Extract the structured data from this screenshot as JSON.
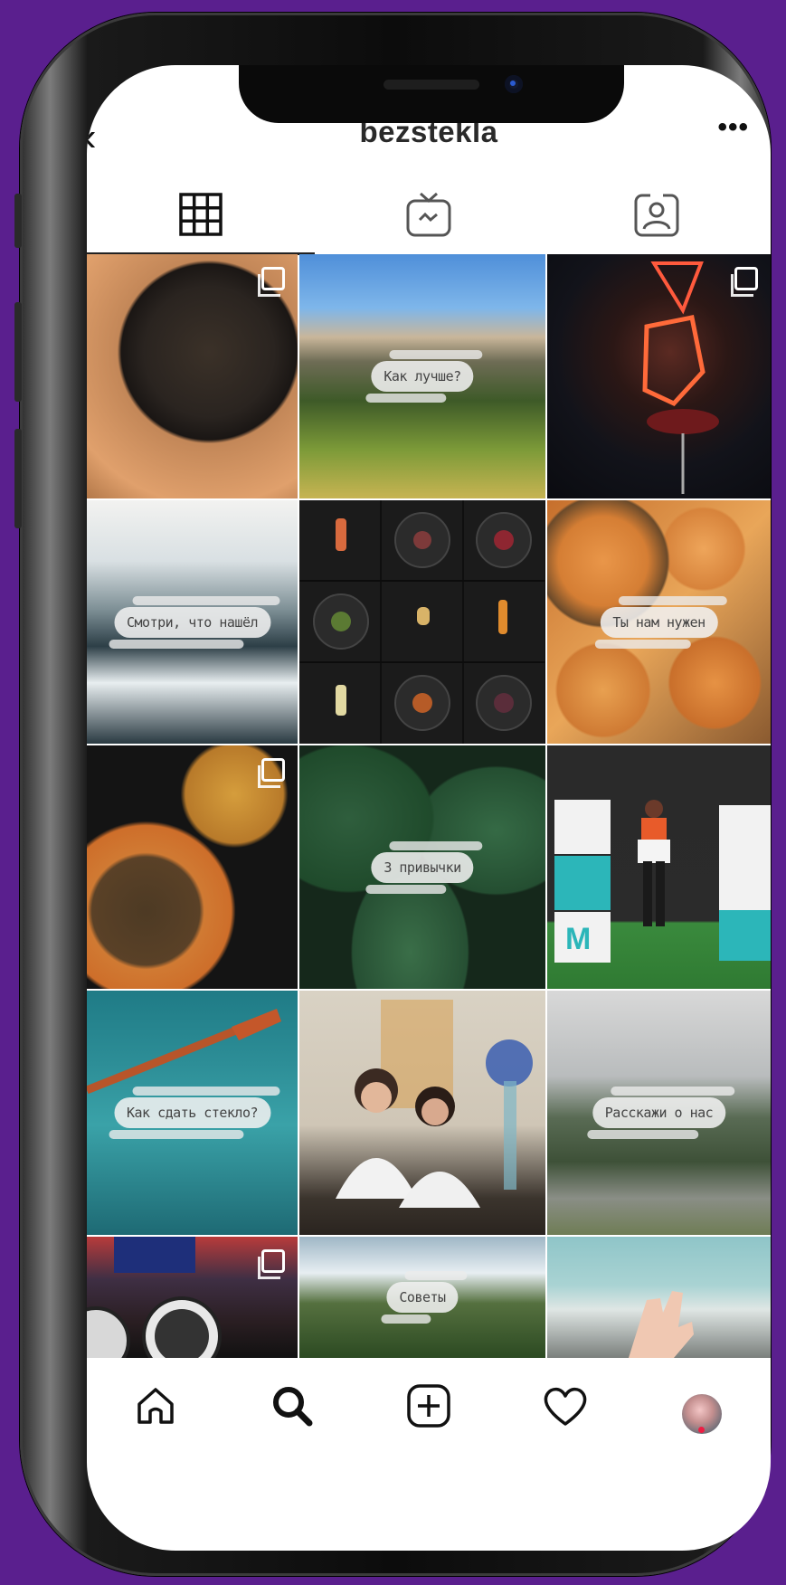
{
  "header": {
    "username": "bezstekla",
    "back_icon": "chevron-left",
    "more_label": "•••"
  },
  "tabs": [
    {
      "name": "grid",
      "icon": "grid-icon",
      "selected": true
    },
    {
      "name": "igtv",
      "icon": "tv-icon",
      "selected": false
    },
    {
      "name": "tagged",
      "icon": "person-tag-icon",
      "selected": false
    }
  ],
  "posts": [
    {
      "id": "escargot",
      "caption": "",
      "multi": true
    },
    {
      "id": "mountains",
      "caption": "Как лучше?",
      "multi": false
    },
    {
      "id": "neon-fist",
      "caption": "",
      "multi": true
    },
    {
      "id": "sea-rocks",
      "caption": "Смотри, что нашёл",
      "multi": false
    },
    {
      "id": "dishes-grid",
      "caption": "",
      "multi": false
    },
    {
      "id": "pumpkins",
      "caption": "Ты нам нужен",
      "multi": false
    },
    {
      "id": "food-plate",
      "caption": "",
      "multi": true
    },
    {
      "id": "leaves",
      "caption": "3 привычки",
      "multi": false
    },
    {
      "id": "exhibit",
      "caption": "",
      "multi": false
    },
    {
      "id": "paddle-sea",
      "caption": "Как сдать стекло?",
      "multi": false
    },
    {
      "id": "two-girls",
      "caption": "",
      "multi": false
    },
    {
      "id": "road-valley",
      "caption": "Расскажи о нас",
      "multi": false
    },
    {
      "id": "coasters",
      "caption": "",
      "multi": true
    },
    {
      "id": "mountain-clouds",
      "caption": "Советы",
      "multi": false
    },
    {
      "id": "hand-fog",
      "caption": "",
      "multi": false
    }
  ],
  "bottom_nav": [
    {
      "name": "home",
      "icon": "home-icon"
    },
    {
      "name": "search",
      "icon": "search-icon"
    },
    {
      "name": "new-post",
      "icon": "plus-square-icon"
    },
    {
      "name": "activity",
      "icon": "heart-icon"
    },
    {
      "name": "profile",
      "icon": "avatar"
    }
  ],
  "colors": {
    "background": "#5a1f8e",
    "notification_dot": "#ee1d43"
  }
}
